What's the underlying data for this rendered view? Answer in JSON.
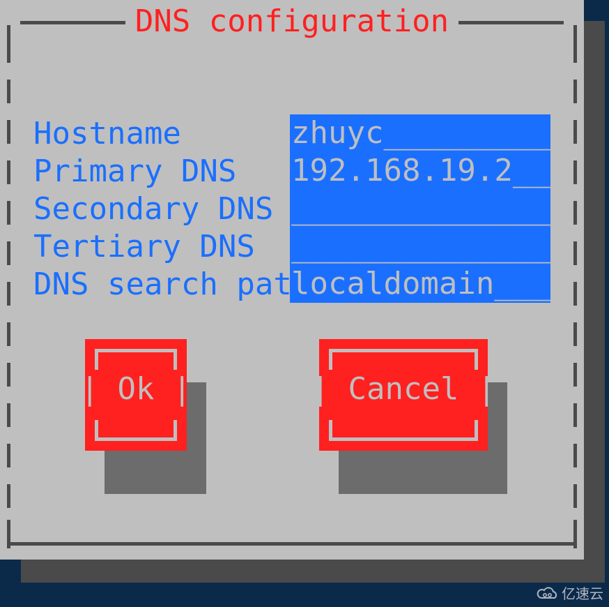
{
  "dialog": {
    "title": "DNS configuration"
  },
  "fields": [
    {
      "label": "Hostname",
      "value": "zhuyc__________"
    },
    {
      "label": "Primary DNS",
      "value": "192.168.19.2___"
    },
    {
      "label": "Secondary DNS",
      "value": "_______________"
    },
    {
      "label": "Tertiary DNS",
      "value": "_______________"
    },
    {
      "label": "DNS search path",
      "value": "localdomain____"
    }
  ],
  "buttons": {
    "ok": "Ok",
    "cancel": "Cancel"
  },
  "watermark": "亿速云",
  "colors": {
    "bg_outer": "#0b2a4a",
    "dialog_bg": "#bfbfbf",
    "shadow": "#4a4a4a",
    "title_fg": "#ff2020",
    "label_fg": "#1a6fff",
    "field_bg": "#1a6fff",
    "field_fg": "#bfbfbf",
    "button_bg": "#ff2020",
    "button_fg": "#bfbfbf",
    "btn_shadow": "#6c6c6c"
  }
}
